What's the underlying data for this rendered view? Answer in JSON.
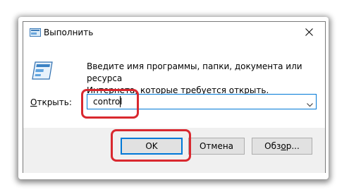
{
  "window": {
    "title": "Выполнить",
    "close_icon": "close-icon",
    "app_icon": "run-icon"
  },
  "content": {
    "description_line1": "Введите имя программы, папки, документа или ресурса",
    "description_line2": "Интернета, которые требуется открыть.",
    "open_label_accel": "О",
    "open_label_rest": "ткрыть:"
  },
  "input": {
    "value": "control",
    "dropdown_icon": "chevron-down-icon"
  },
  "buttons": {
    "ok": "OK",
    "cancel": "Отмена",
    "browse_pre": "Обз",
    "browse_accel": "о",
    "browse_post": "р..."
  },
  "colors": {
    "highlight": "#d9282f",
    "focus": "#0078d7",
    "footer_bg": "#f0f0f0"
  }
}
